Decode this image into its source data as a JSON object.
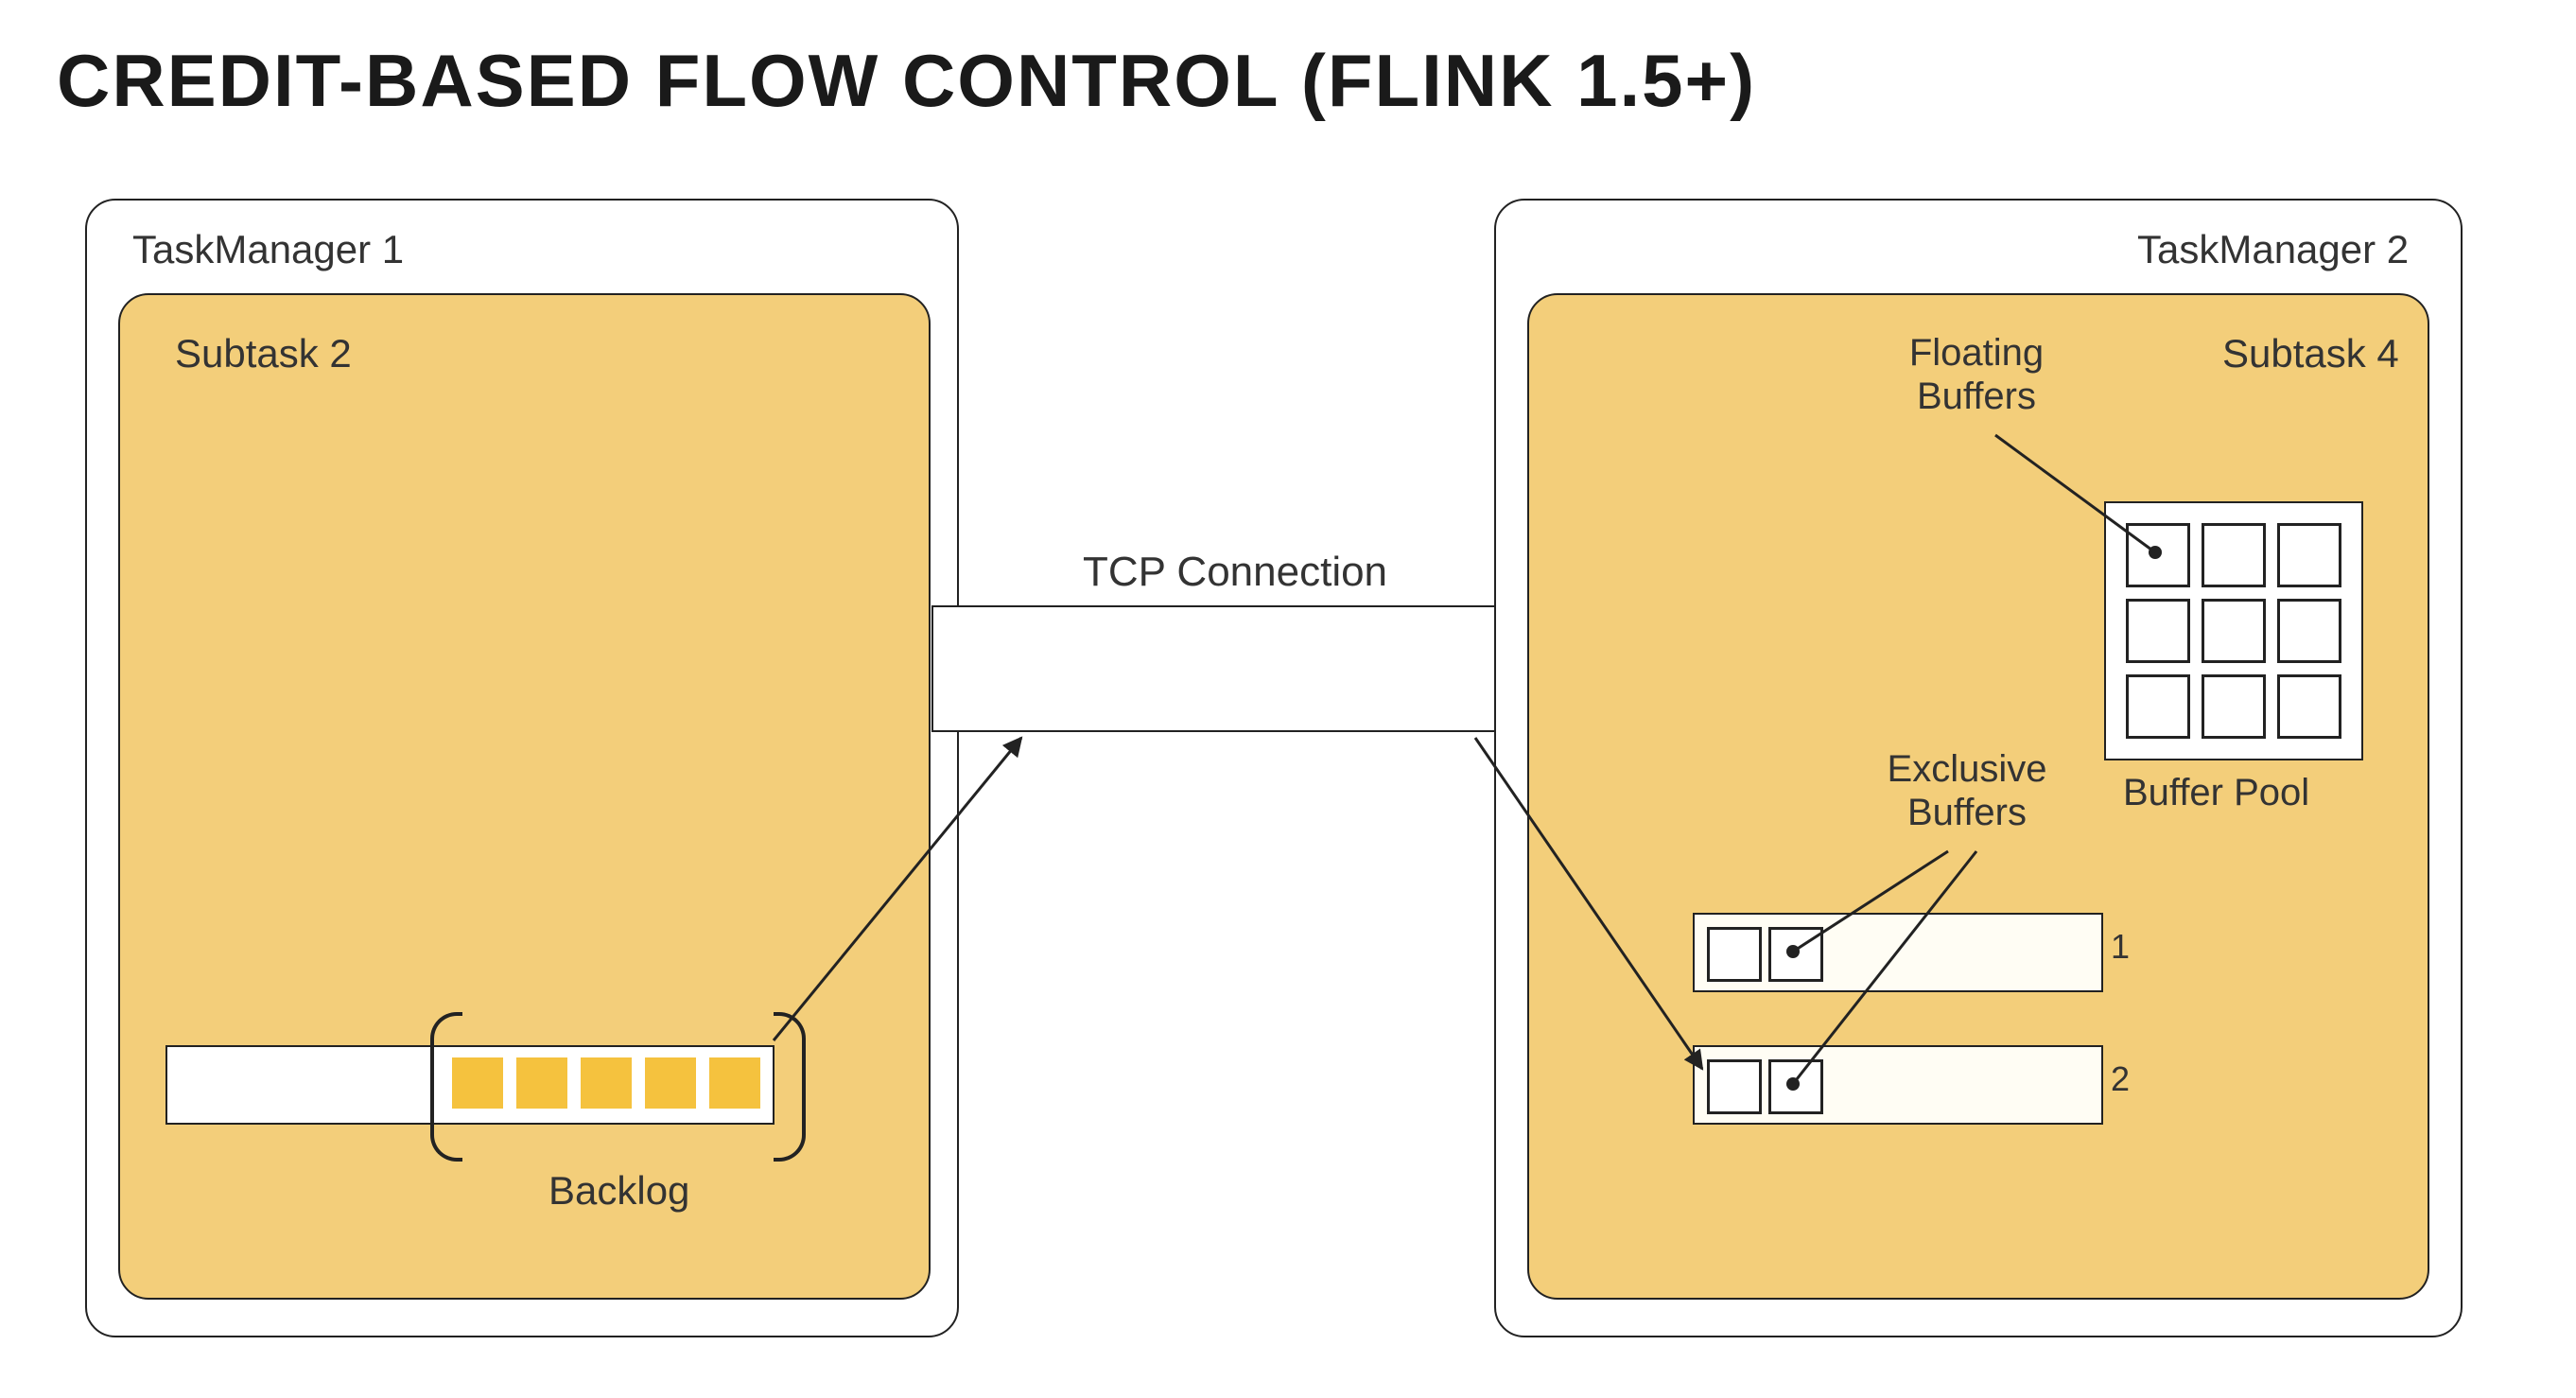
{
  "title": "CREDIT-BASED FLOW CONTROL (FLINK 1.5+)",
  "tcp_label": "TCP Connection",
  "tm1": {
    "label": "TaskManager 1",
    "subtask": {
      "label": "Subtask 2",
      "backlog_label": "Backlog",
      "backlog_size": 5,
      "queue_capacity": 8
    }
  },
  "tm2": {
    "label": "TaskManager 2",
    "subtask": {
      "label": "Subtask 4",
      "floating_label": "Floating\nBuffers",
      "exclusive_label": "Exclusive\nBuffers",
      "buffer_pool_label": "Buffer Pool",
      "buffer_pool_cells": 9,
      "channels": [
        {
          "id": "1",
          "exclusive": 2
        },
        {
          "id": "2",
          "exclusive": 2
        }
      ]
    }
  }
}
